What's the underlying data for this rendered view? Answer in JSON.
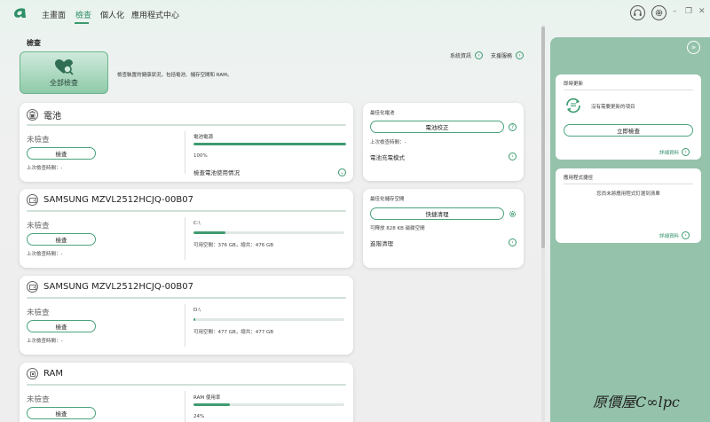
{
  "topbar": {
    "tabs": [
      "主畫面",
      "檢查",
      "個人化",
      "應用程式中心"
    ],
    "active_tab": 1,
    "window_controls": [
      "–",
      "❐",
      "✕"
    ]
  },
  "page": {
    "title": "檢查",
    "links": [
      "系統資訊",
      "支援服務"
    ],
    "fullscan_label": "全部檢查",
    "description": "檢查裝置的健康狀況，包括電池、儲存空間和 RAM。"
  },
  "battery": {
    "title": "電池",
    "status": "未檢查",
    "button": "檢查",
    "last_check": "上次檢查時間：-",
    "power_label": "電池電源",
    "power_percent": "100%",
    "power_fraction": 1.0,
    "usage_link": "檢查電池使用情況"
  },
  "disks": [
    {
      "title": "SAMSUNG MZVL2512HCJQ-00B07",
      "status": "未檢查",
      "button": "檢查",
      "last_check": "上次檢查時間：-",
      "drive": "C:\\",
      "used_fraction": 0.21,
      "space_text": "可用空間：376 GB，總共：476 GB"
    },
    {
      "title": "SAMSUNG MZVL2512HCJQ-00B07",
      "status": "未檢查",
      "button": "檢查",
      "last_check": "上次檢查時間：-",
      "drive": "D:\\",
      "used_fraction": 0.01,
      "space_text": "可用空間：477 GB，總共：477 GB"
    }
  ],
  "ram": {
    "title": "RAM",
    "status": "未檢查",
    "button": "檢查",
    "usage_label": "RAM 使用率",
    "usage_percent": "24%",
    "usage_fraction": 0.24
  },
  "optimize_battery": {
    "title": "最佳化電池",
    "button": "電池校正",
    "last_check": "上次檢查時間：-",
    "mode_link": "電池充電模式"
  },
  "optimize_storage": {
    "title": "最佳化儲存空間",
    "button": "快捷清理",
    "freeable": "可釋放 828 KB 磁碟空間",
    "advanced_link": "進階清理"
  },
  "right_panel": {
    "update": {
      "title": "即時更新",
      "message": "沒有需要更新的項目",
      "button": "立即檢查",
      "more": "詳細資料"
    },
    "shortcuts": {
      "title": "應用程式捷徑",
      "message": "您尚未將應用程式釘選到清單",
      "more": "詳細資料"
    }
  },
  "watermark": "原價屋C∞lpc",
  "colors": {
    "accent": "#3a9a6e",
    "panel": "#94c2aa"
  }
}
